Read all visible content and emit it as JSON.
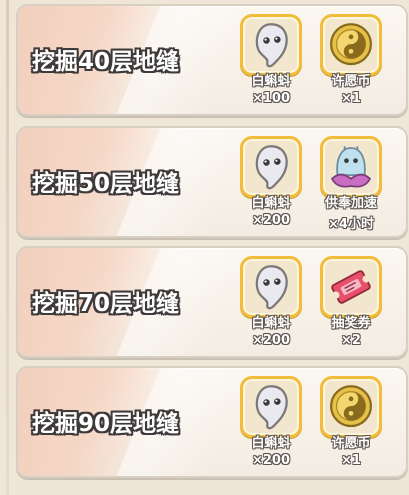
{
  "tasks": [
    {
      "title": "挖掘40层地缝",
      "rewards": [
        {
          "name": "白蝌蚪",
          "qty": "×100",
          "icon": "white-tadpole-icon"
        },
        {
          "name": "许愿币",
          "qty": "×1",
          "icon": "wish-coin-icon"
        }
      ]
    },
    {
      "title": "挖掘50层地缝",
      "rewards": [
        {
          "name": "白蝌蚪",
          "qty": "×200",
          "icon": "white-tadpole-icon"
        },
        {
          "name": "供奉加速",
          "qty": "×4小时",
          "icon": "offering-speedup-icon"
        }
      ]
    },
    {
      "title": "挖掘70层地缝",
      "rewards": [
        {
          "name": "白蝌蚪",
          "qty": "×200",
          "icon": "white-tadpole-icon"
        },
        {
          "name": "抽奖券",
          "qty": "×2",
          "icon": "lottery-ticket-icon"
        }
      ]
    },
    {
      "title": "挖掘90层地缝",
      "rewards": [
        {
          "name": "白蝌蚪",
          "qty": "×200",
          "icon": "white-tadpole-icon"
        },
        {
          "name": "许愿币",
          "qty": "×1",
          "icon": "wish-coin-icon"
        }
      ]
    }
  ],
  "colors": {
    "slot_border": "#f1bd3a",
    "stripe": "#f0c7b3",
    "card_bg": "#f7f1e8"
  }
}
